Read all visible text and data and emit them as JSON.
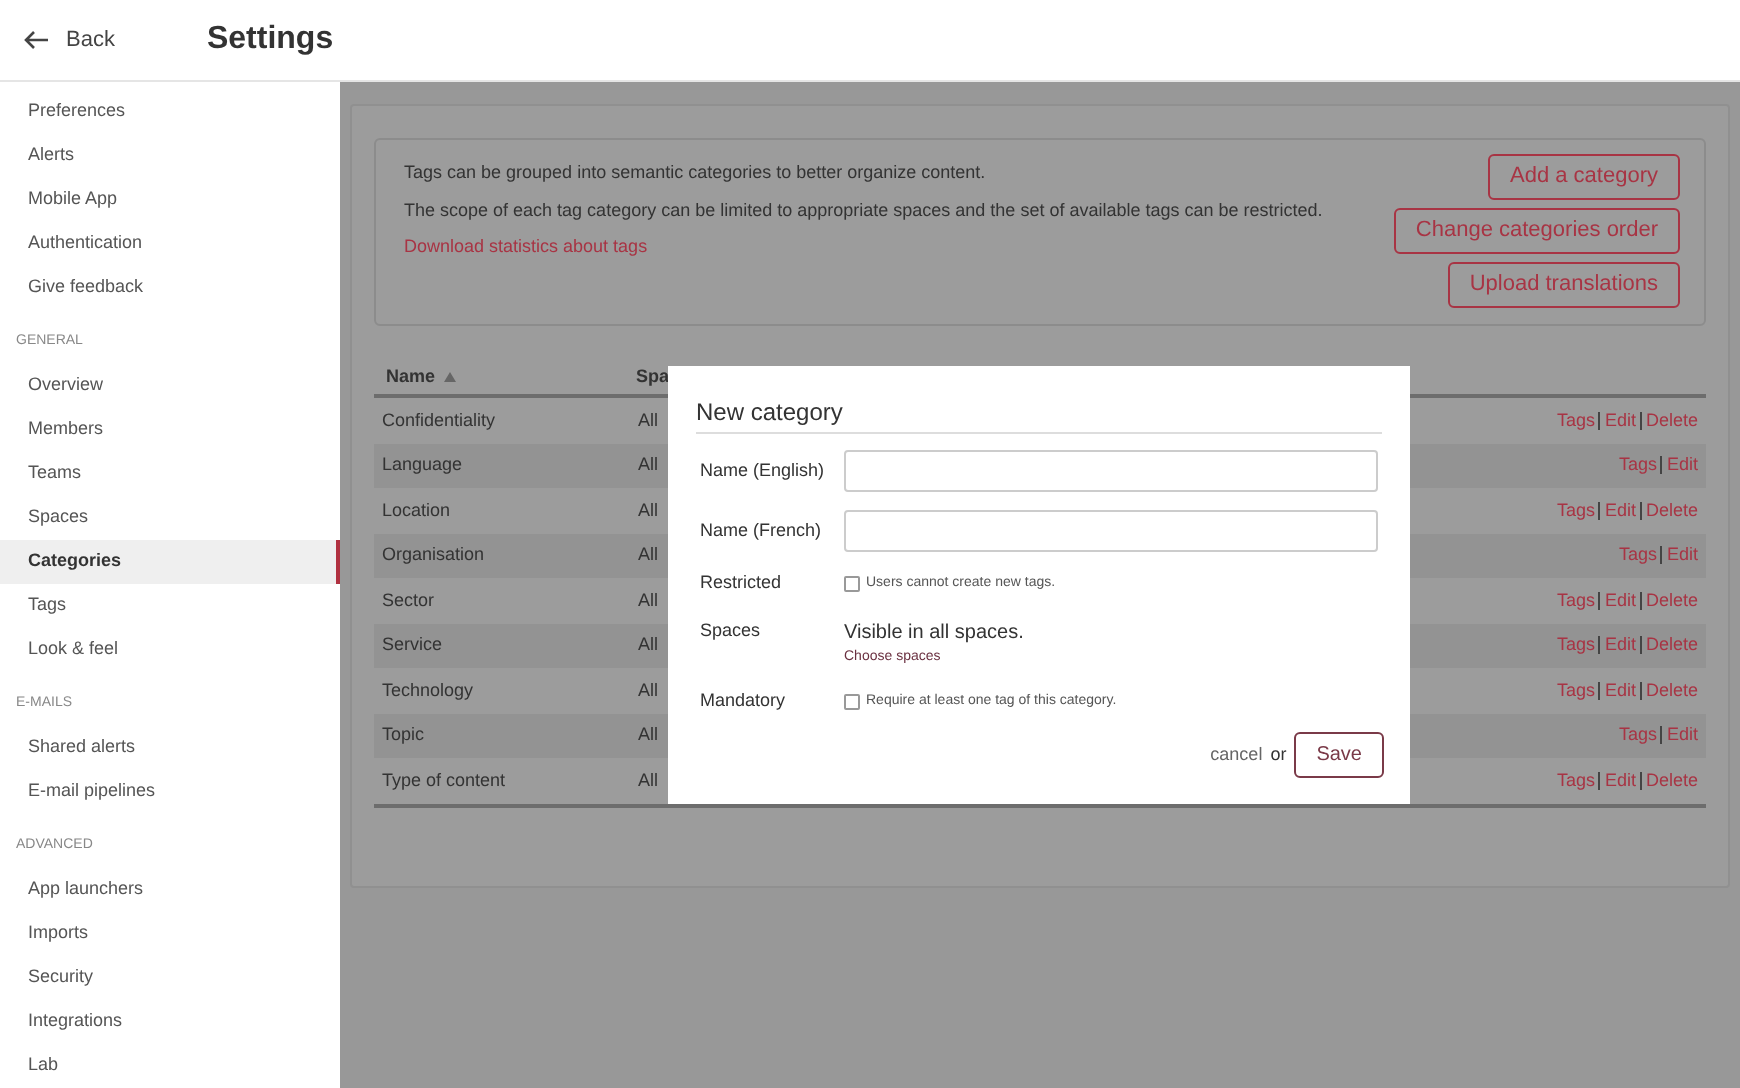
{
  "header": {
    "back": "Back",
    "title": "Settings"
  },
  "sidebar": {
    "sections": [
      {
        "items": [
          {
            "label": "Preferences",
            "selected": false
          },
          {
            "label": "Alerts",
            "selected": false
          },
          {
            "label": "Mobile App",
            "selected": false
          },
          {
            "label": "Authentication",
            "selected": false
          },
          {
            "label": "Give feedback",
            "selected": false
          }
        ]
      },
      {
        "title": "GENERAL",
        "items": [
          {
            "label": "Overview",
            "selected": false
          },
          {
            "label": "Members",
            "selected": false
          },
          {
            "label": "Teams",
            "selected": false
          },
          {
            "label": "Spaces",
            "selected": false
          },
          {
            "label": "Categories",
            "selected": true
          },
          {
            "label": "Tags",
            "selected": false
          },
          {
            "label": "Look & feel",
            "selected": false
          }
        ]
      },
      {
        "title": "E-MAILS",
        "items": [
          {
            "label": "Shared alerts",
            "selected": false
          },
          {
            "label": "E-mail pipelines",
            "selected": false
          }
        ]
      },
      {
        "title": "ADVANCED",
        "items": [
          {
            "label": "App launchers",
            "selected": false
          },
          {
            "label": "Imports",
            "selected": false
          },
          {
            "label": "Security",
            "selected": false
          },
          {
            "label": "Integrations",
            "selected": false
          },
          {
            "label": "Lab",
            "selected": false
          }
        ]
      }
    ]
  },
  "intro": {
    "lines": [
      "Tags can be grouped into semantic categories to better organize content.",
      "The scope of each tag category can be limited to appropriate spaces and the set of available tags can be restricted."
    ],
    "link": "Download statistics about tags",
    "buttons": [
      "Add a category",
      "Change categories order",
      "Upload translations"
    ]
  },
  "table": {
    "columns": [
      "Name",
      "Spa"
    ],
    "rows": [
      {
        "name": "Confidentiality",
        "spaces": "All",
        "actions": [
          "Tags",
          "Edit",
          "Delete"
        ]
      },
      {
        "name": "Language",
        "spaces": "All",
        "actions": [
          "Tags",
          "Edit"
        ]
      },
      {
        "name": "Location",
        "spaces": "All",
        "actions": [
          "Tags",
          "Edit",
          "Delete"
        ]
      },
      {
        "name": "Organisation",
        "spaces": "All",
        "actions": [
          "Tags",
          "Edit"
        ]
      },
      {
        "name": "Sector",
        "spaces": "All",
        "actions": [
          "Tags",
          "Edit",
          "Delete"
        ]
      },
      {
        "name": "Service",
        "spaces": "All",
        "actions": [
          "Tags",
          "Edit",
          "Delete"
        ]
      },
      {
        "name": "Technology",
        "spaces": "All",
        "actions": [
          "Tags",
          "Edit",
          "Delete"
        ]
      },
      {
        "name": "Topic",
        "spaces": "All",
        "actions": [
          "Tags",
          "Edit"
        ]
      },
      {
        "name": "Type of content",
        "spaces": "All",
        "actions": [
          "Tags",
          "Edit",
          "Delete"
        ]
      }
    ]
  },
  "dialog": {
    "title": "New category",
    "fields": [
      {
        "kind": "text",
        "label": "Name (English)"
      },
      {
        "kind": "text",
        "label": "Name (French)"
      },
      {
        "kind": "checkbox",
        "label": "Restricted",
        "text": "Users cannot create new tags.",
        "checked": false
      },
      {
        "kind": "info",
        "label": "Spaces",
        "text": "Visible in all spaces.",
        "link": "Choose spaces"
      },
      {
        "kind": "checkbox",
        "label": "Mandatory",
        "text": "Require at least one tag of this category.",
        "checked": false
      }
    ],
    "cancel": "cancel",
    "or": "or",
    "save": "Save"
  }
}
